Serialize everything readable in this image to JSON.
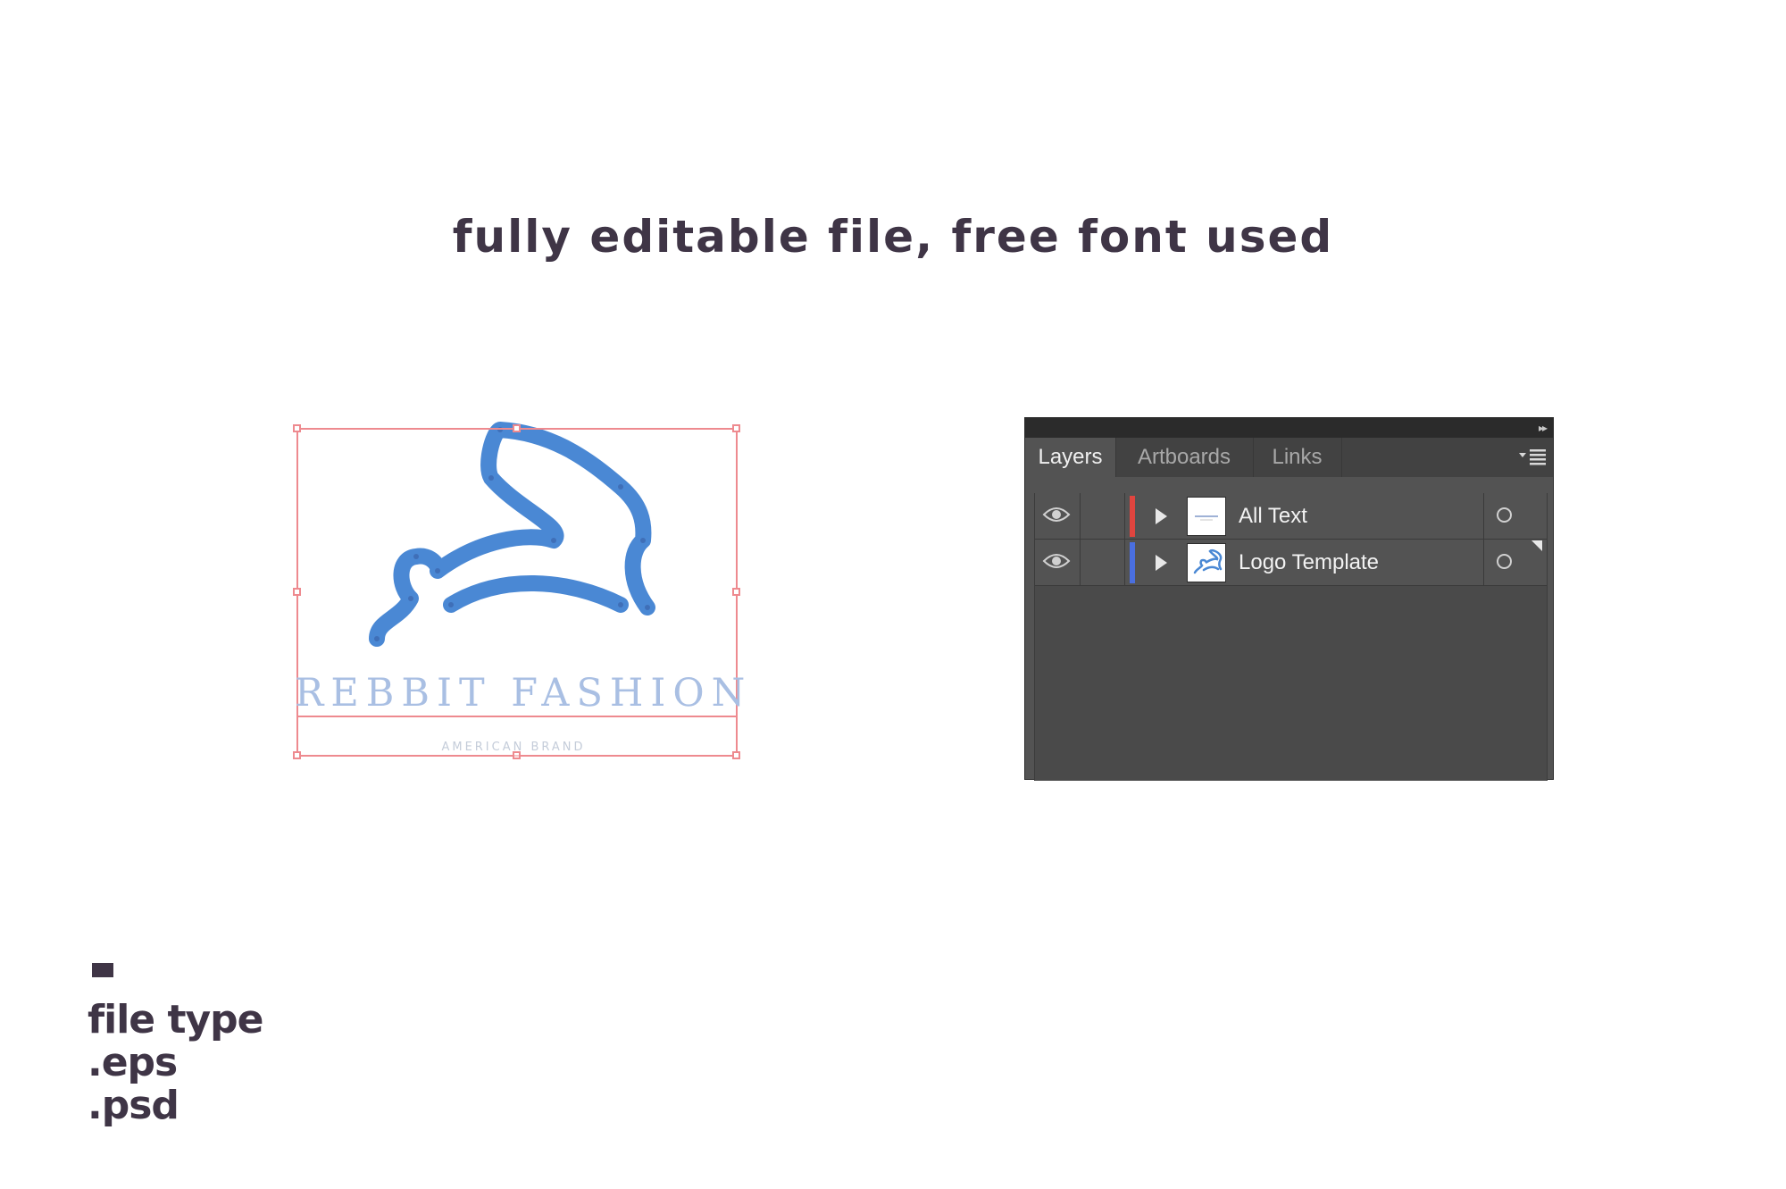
{
  "headline": "fully editable file, free font used",
  "logo": {
    "title": "REBBIT FASHION",
    "subtitle": "AMERICAN BRAND",
    "colors": {
      "rabbit": "#4a88d4",
      "selection": "#ee8a8f"
    }
  },
  "panel": {
    "collapse_icon": "double-chevron-right-icon",
    "tabs": [
      {
        "label": "Layers",
        "active": true
      },
      {
        "label": "Artboards",
        "active": false
      },
      {
        "label": "Links",
        "active": false
      }
    ],
    "menu_icon": "panel-menu-icon",
    "layers": [
      {
        "name": "All Text",
        "visible": true,
        "color": "#e0453f",
        "thumbnail": "text-thumbnail"
      },
      {
        "name": "Logo Template",
        "visible": true,
        "color": "#4a6fe0",
        "thumbnail": "rabbit-thumbnail"
      }
    ]
  },
  "file_type": {
    "label": "file type",
    "formats": [
      ".eps",
      ".psd"
    ]
  }
}
